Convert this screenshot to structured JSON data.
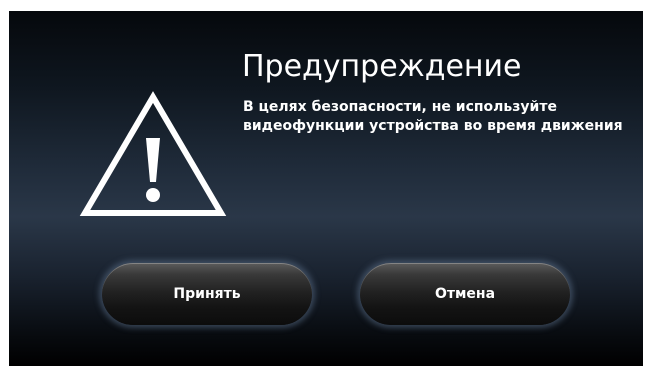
{
  "dialog": {
    "title": "Предупреждение",
    "message": "В целях безопасности, не используйте видеофункции устройства во время движения",
    "icon": "warning-icon"
  },
  "buttons": {
    "accept_label": "Принять",
    "cancel_label": "Отмена"
  },
  "colors": {
    "text": "#ffffff",
    "background_mid": "#2a3748",
    "background_dark": "#000000"
  }
}
